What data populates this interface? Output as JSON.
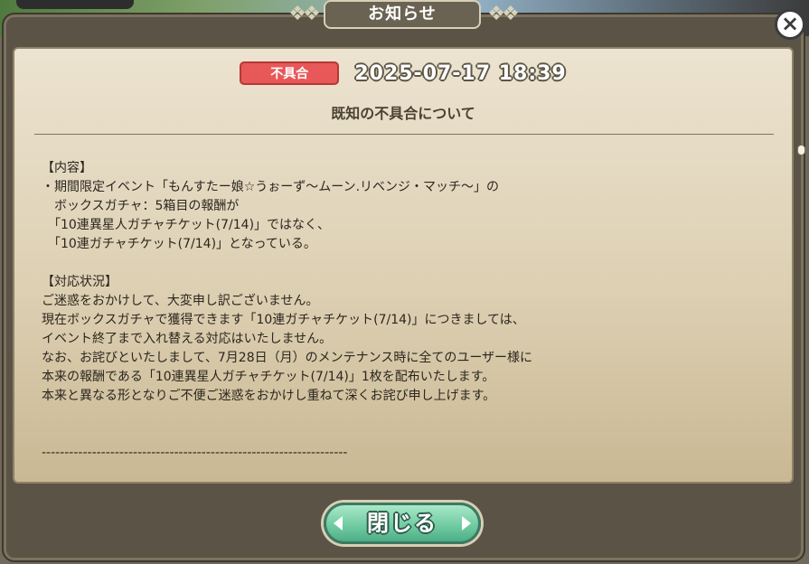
{
  "window": {
    "title": "お知らせ",
    "title_wing_left": "❖❖",
    "title_wing_right": "❖❖",
    "close_icon": "×"
  },
  "notice": {
    "tag": "不具合",
    "date": "2025-07-17 18:39",
    "subject": "既知の不具合について",
    "body_lines": [
      "【内容】",
      "・期間限定イベント「もんすたー娘☆うぉーず〜ムーン.リベンジ・マッチ〜」の",
      "　ボックスガチャ：5箱目の報酬が",
      "　「10連異星人ガチャチケット(7/14)」ではなく、",
      "　「10連ガチャチケット(7/14)」となっている。",
      "",
      "【対応状況】",
      "ご迷惑をおかけして、大変申し訳ございません。",
      "現在ボックスガチャで獲得できます「10連ガチャチケット(7/14)」につきましては、",
      "イベント終了まで入れ替える対応はいたしません。",
      "なお、お詫びといたしまして、7月28日（月）のメンテナンス時に全てのユーザー様に",
      "本来の報酬である「10連異星人ガチャチケット(7/14)」1枚を配布いたします。",
      "本来と異なる形となりご不便ご迷惑をおかけし重ねて深くお詫び申し上げます。",
      "",
      "",
      "-------------------------------------------------------------------"
    ]
  },
  "footer": {
    "close_button_label": "閉じる"
  },
  "colors": {
    "tag_red": "#e85858",
    "button_green": "#6cc9a0",
    "parchment": "#ddd0b3"
  },
  "icons": {
    "close": "close-icon",
    "arrow_left": "arrow-left-icon",
    "arrow_right": "arrow-right-icon"
  }
}
